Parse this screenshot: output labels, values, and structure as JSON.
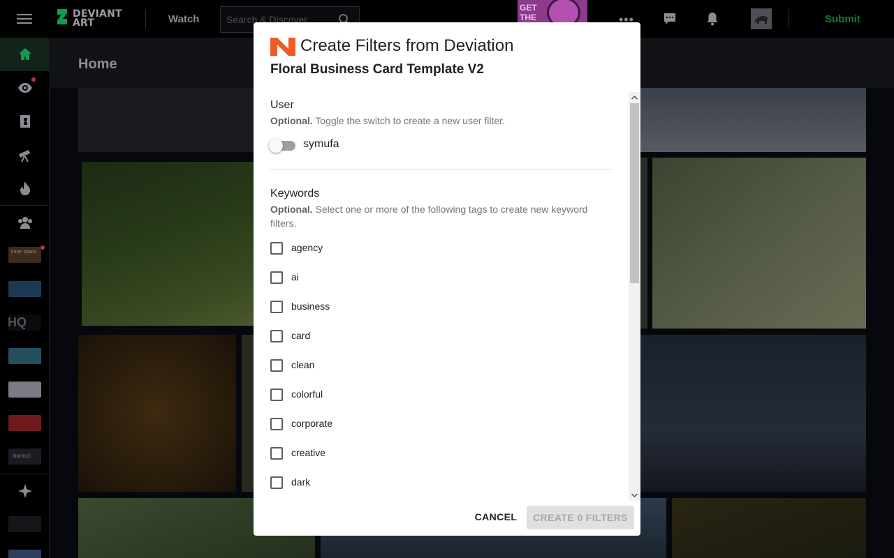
{
  "topbar": {
    "logo_text": "DEVIANT ART",
    "logo_text_line1": "DEVIANT",
    "logo_text_line2": "ART",
    "watch_label": "Watch",
    "search_placeholder": "Search & Discover",
    "banner_text_line1": "GET",
    "banner_text_line2": "THE",
    "more_label": "•••",
    "submit_label": "Submit"
  },
  "sidebar": {
    "items": [
      {
        "icon": "home-icon"
      },
      {
        "icon": "eye-icon",
        "has_notification": true
      },
      {
        "icon": "deviation-icon"
      },
      {
        "icon": "telescope-icon"
      },
      {
        "icon": "fire-icon"
      },
      {
        "icon": "groups-icon"
      }
    ],
    "group_thumbs": [
      {
        "label": "inner space",
        "has_notification": true
      },
      {
        "label": ""
      },
      {
        "label": "HQ"
      },
      {
        "label": ""
      },
      {
        "label": ""
      },
      {
        "label": ""
      },
      {
        "label": "banicci"
      }
    ]
  },
  "main": {
    "title": "Home"
  },
  "modal": {
    "title": "Create Filters from Deviation",
    "deviation_title": "Floral Business Card Template V2",
    "user_section": {
      "title": "User",
      "helper_bold": "Optional.",
      "helper_text": " Toggle the switch to create a new user filter.",
      "username": "symufa",
      "toggle_on": false
    },
    "keywords_section": {
      "title": "Keywords",
      "helper_bold": "Optional.",
      "helper_text": " Select one or more of the following tags to create new keyword filters.",
      "tags": [
        "agency",
        "ai",
        "business",
        "card",
        "clean",
        "colorful",
        "corporate",
        "creative",
        "dark"
      ]
    },
    "cancel_label": "CANCEL",
    "create_label": "CREATE 0 FILTERS"
  },
  "colors": {
    "accent_green": "#0e7a3e",
    "logo_orange": "#f15a24",
    "modal_bg": "#ffffff",
    "disabled_button_bg": "#e0e0e0",
    "notification_red": "#c0343b"
  }
}
